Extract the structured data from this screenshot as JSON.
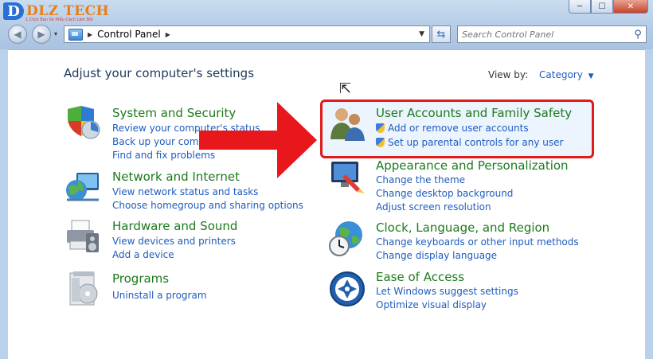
{
  "watermark": {
    "brand": "DLZ TECH",
    "tagline": "1 Click Bạn Sẽ Hiểu Cách Làm Bởi"
  },
  "window": {
    "minimize": "─",
    "maximize": "☐",
    "close": "✕"
  },
  "address": {
    "crumb": "Control Panel"
  },
  "search": {
    "placeholder": "Search Control Panel"
  },
  "main": {
    "heading": "Adjust your computer's settings",
    "view_by_label": "View by:",
    "view_by_value": "Category"
  },
  "categories": [
    {
      "title": "System and Security",
      "icon": "shield-icon",
      "links": [
        "Review your computer's status",
        "Back up your computer",
        "Find and fix problems"
      ]
    },
    {
      "title": "Network and Internet",
      "icon": "network-globe-icon",
      "links": [
        "View network status and tasks",
        "Choose homegroup and sharing options"
      ]
    },
    {
      "title": "Hardware and Sound",
      "icon": "printer-icon",
      "links": [
        "View devices and printers",
        "Add a device"
      ]
    },
    {
      "title": "Programs",
      "icon": "programs-icon",
      "links": [
        "Uninstall a program"
      ]
    },
    {
      "title": "User Accounts and Family Safety",
      "icon": "users-icon",
      "links": [
        "Add or remove user accounts",
        "Set up parental controls for any user"
      ]
    },
    {
      "title": "Appearance and Personalization",
      "icon": "monitor-paint-icon",
      "links": [
        "Change the theme",
        "Change desktop background",
        "Adjust screen resolution"
      ]
    },
    {
      "title": "Clock, Language, and Region",
      "icon": "clock-globe-icon",
      "links": [
        "Change keyboards or other input methods",
        "Change display language"
      ]
    },
    {
      "title": "Ease of Access",
      "icon": "accessibility-icon",
      "links": [
        "Let Windows suggest settings",
        "Optimize visual display"
      ]
    }
  ],
  "colors": {
    "category_title": "#1c7a1c",
    "link": "#1e5cbf",
    "annotation_red": "#e8171c"
  }
}
